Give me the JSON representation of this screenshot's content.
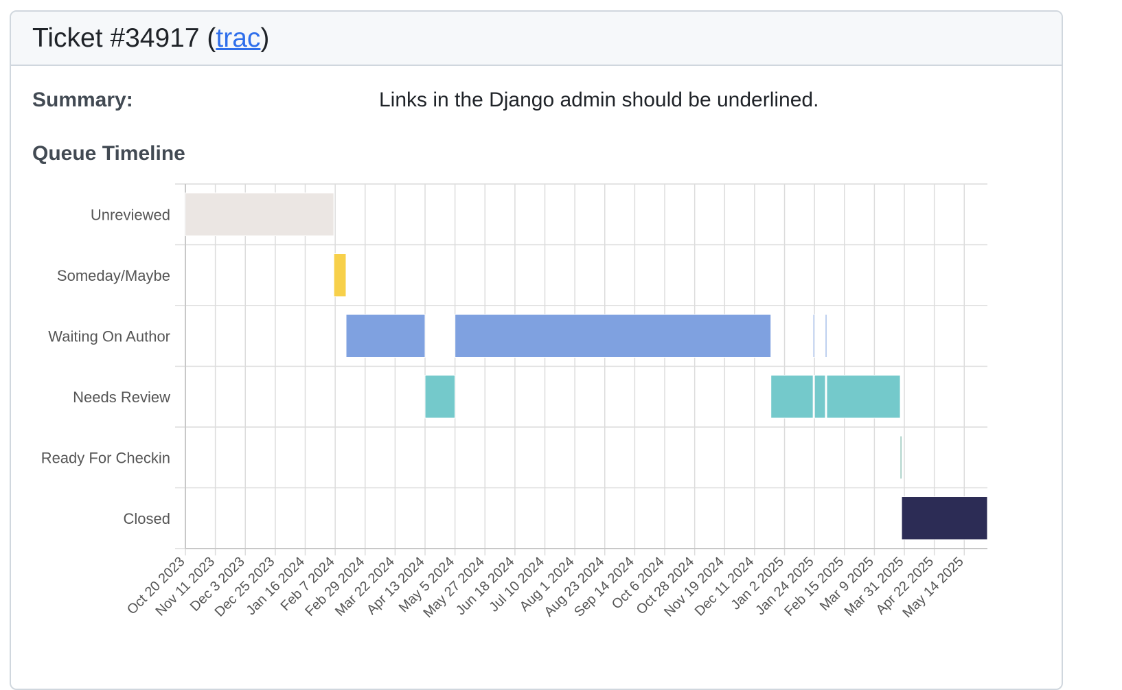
{
  "header": {
    "title_prefix": "Ticket #34917 (",
    "link_text": "trac",
    "title_suffix": ")"
  },
  "summary": {
    "label": "Summary:",
    "value": "Links in the Django admin should be underlined."
  },
  "section_title": "Queue Timeline",
  "chart_data": {
    "type": "timeline",
    "categories": [
      "Unreviewed",
      "Someday/Maybe",
      "Waiting On Author",
      "Needs Review",
      "Ready For Checkin",
      "Closed"
    ],
    "x_range": [
      "2023-10-20",
      "2025-05-31"
    ],
    "x_ticks": [
      "2023-10-20",
      "2023-11-11",
      "2023-12-03",
      "2023-12-25",
      "2024-01-16",
      "2024-02-07",
      "2024-02-29",
      "2024-03-22",
      "2024-04-13",
      "2024-05-05",
      "2024-05-27",
      "2024-06-18",
      "2024-07-10",
      "2024-08-01",
      "2024-08-23",
      "2024-09-14",
      "2024-10-06",
      "2024-10-28",
      "2024-11-19",
      "2024-12-11",
      "2025-01-02",
      "2025-01-24",
      "2025-02-15",
      "2025-03-09",
      "2025-03-31",
      "2025-04-22",
      "2025-05-14"
    ],
    "x_tick_labels": [
      "Oct 20 2023",
      "Nov 11 2023",
      "Dec 3 2023",
      "Dec 25 2023",
      "Jan 16 2024",
      "Feb 7 2024",
      "Feb 29 2024",
      "Mar 22 2024",
      "Apr 13 2024",
      "May 5 2024",
      "May 27 2024",
      "Jun 18 2024",
      "Jul 10 2024",
      "Aug 1 2024",
      "Aug 23 2024",
      "Sep 14 2024",
      "Oct 6 2024",
      "Oct 28 2024",
      "Nov 19 2024",
      "Dec 11 2024",
      "Jan 2 2025",
      "Jan 24 2025",
      "Feb 15 2025",
      "Mar 9 2025",
      "Mar 31 2025",
      "Apr 22 2025",
      "May 14 2025"
    ],
    "grid": true,
    "colors": {
      "Unreviewed": "#ebe6e3",
      "Someday/Maybe": "#f7d04a",
      "Waiting On Author": "#7fa1e0",
      "Needs Review": "#74c9cb",
      "Ready For Checkin": "#5fa896",
      "Closed": "#2c2c55"
    },
    "segments": [
      {
        "category": "Unreviewed",
        "start": "2023-10-20",
        "end": "2024-02-06"
      },
      {
        "category": "Someday/Maybe",
        "start": "2024-02-06",
        "end": "2024-02-15"
      },
      {
        "category": "Waiting On Author",
        "start": "2024-02-15",
        "end": "2024-04-13"
      },
      {
        "category": "Needs Review",
        "start": "2024-04-13",
        "end": "2024-05-05"
      },
      {
        "category": "Waiting On Author",
        "start": "2024-05-05",
        "end": "2024-12-23"
      },
      {
        "category": "Needs Review",
        "start": "2024-12-23",
        "end": "2025-01-23"
      },
      {
        "category": "Waiting On Author",
        "start": "2025-01-23",
        "end": "2025-01-24"
      },
      {
        "category": "Needs Review",
        "start": "2025-01-24",
        "end": "2025-02-01"
      },
      {
        "category": "Waiting On Author",
        "start": "2025-02-01",
        "end": "2025-02-02"
      },
      {
        "category": "Needs Review",
        "start": "2025-02-02",
        "end": "2025-03-28"
      },
      {
        "category": "Ready For Checkin",
        "start": "2025-03-28",
        "end": "2025-03-29"
      },
      {
        "category": "Closed",
        "start": "2025-03-29",
        "end": "2025-05-31"
      }
    ]
  }
}
